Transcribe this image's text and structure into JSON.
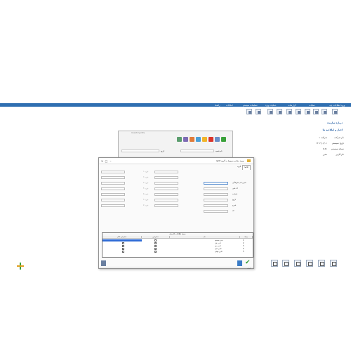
{
  "menu": [
    "ورود اطلاعات پایه",
    "عملیات",
    "گزارشات",
    "عملیات ویژه",
    "تنظیمات سیستم",
    "امکانات",
    "راهنما"
  ],
  "links": {
    "about": "درباره سازنده",
    "news": "اخبار و اطلاعیه ها"
  },
  "info": {
    "company_label": "نام شرکت",
    "company_value": "شرکت ۱",
    "period_label": "تاریخ سیستم",
    "period_value": "۱۴۰۲/۰۱/۰۱",
    "version_label": "نسخه سیستم",
    "version_value": "۷.۵۱",
    "user_label": "نام کاربر",
    "user_value": "مدیر"
  },
  "back_dialog": {
    "title": "Inventory (کالا)",
    "filter_label": "نام شعبه",
    "date_label": "تاریخ"
  },
  "dialog": {
    "title": "ورود مقادیر مربوط به گروه کالاها",
    "tab_1": "کالاها",
    "tab_2": "گروه",
    "left_fields": [
      "دوره ۱",
      "دوره ۲",
      "دوره ۳",
      "دوره ۴",
      "دوره ۵",
      "دوره ۶",
      "دوره ۷"
    ],
    "right_labels": [
      "نام و نام خانوادگی",
      "کد ملی",
      "شماره",
      "تاریخ",
      "شرح",
      "کد",
      "مبلغ"
    ],
    "grid_title": "جدول اطلاعات کاربران",
    "grid_headers": [
      "ردیف",
      "نام",
      "دسترسی",
      "وضعیت",
      "دسترسی کامل"
    ],
    "grid_rows": [
      {
        "num": "1",
        "name": "مدیر سیستم"
      },
      {
        "num": "2",
        "name": "کاربر اول"
      },
      {
        "num": "3",
        "name": "کاربر دوم"
      },
      {
        "num": "4",
        "name": "کاربر سوم"
      },
      {
        "num": "5",
        "name": "کاربر چهارم"
      }
    ],
    "status": "آماده"
  },
  "colors": {
    "accent": "#2f6fb1",
    "ok": "#3aa13a",
    "delete": "#d9342b"
  }
}
